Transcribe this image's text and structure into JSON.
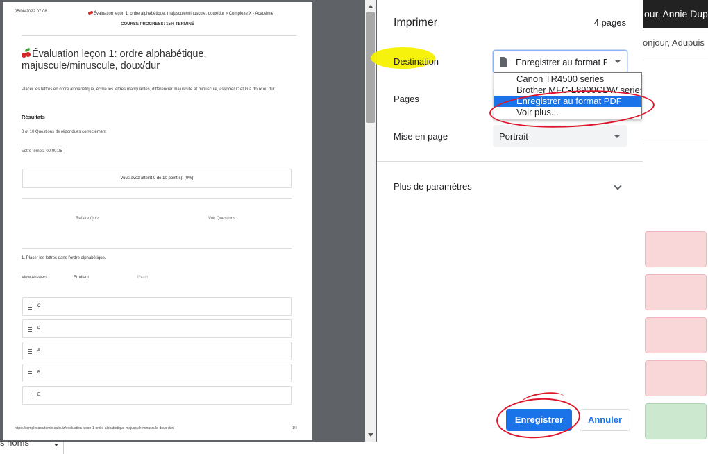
{
  "background_page": {
    "topbar_text": "our, Annie Dupuis",
    "greeting": "onjour, Adupuis",
    "footer_select_text": "s noms"
  },
  "preview": {
    "header_date": "05/08/2022 07:08",
    "header_title": "Évaluation leçon 1: ordre alphabétique, majuscule/minuscule, doux/dur » Complexe X - Académie",
    "course_progress": "COURSE PROGRESS: 15% TERMINÉ",
    "title": "Évaluation leçon 1: ordre alphabétique, majuscule/minuscule, doux/dur",
    "description": "Placer les lettres en ordre alphabétique, écrire les lettres manquantes, différencier majuscule et minuscule, associer C et G à doux ou dur.",
    "results_heading": "Résultats",
    "questions_answered": "0 of 10 Questions de répondues correctement",
    "your_time": "Votre temps: 00:00:05",
    "score_text": "Vous avez atteint 0 de 10 point(s), (0%)",
    "redo_quiz": "Refaire Quiz",
    "view_questions": "Voir Questions",
    "question_1": "1. Placer les lettres dans l'ordre alphabétique.",
    "view_answers_label": "View Answers:",
    "student_label": "Etudiant",
    "exact_label": "Exact",
    "answers": [
      "C",
      "D",
      "A",
      "B",
      "E"
    ],
    "footer_url": "https://complexacademie.ca/quiz/evaluation-lecon-1-ordre-alphabetique-majuscule-minuscule-doux-dur/",
    "footer_page": "1/4"
  },
  "print_dialog": {
    "title": "Imprimer",
    "page_count": "4 pages",
    "destination_label": "Destination",
    "destination_value": "Enregistrer au format PDF",
    "destination_options": [
      "Canon TR4500 series",
      "Brother MFC-L8900CDW series",
      "Enregistrer au format PDF",
      "Voir plus..."
    ],
    "selected_option_index": 2,
    "pages_label": "Pages",
    "layout_label": "Mise en page",
    "layout_value": "Portrait",
    "more_settings": "Plus de paramètres",
    "save_button": "Enregistrer",
    "cancel_button": "Annuler"
  },
  "colors": {
    "accent_blue": "#1a73e8",
    "highlight_yellow": "#f6f100",
    "annotation_red": "#e0142a"
  }
}
